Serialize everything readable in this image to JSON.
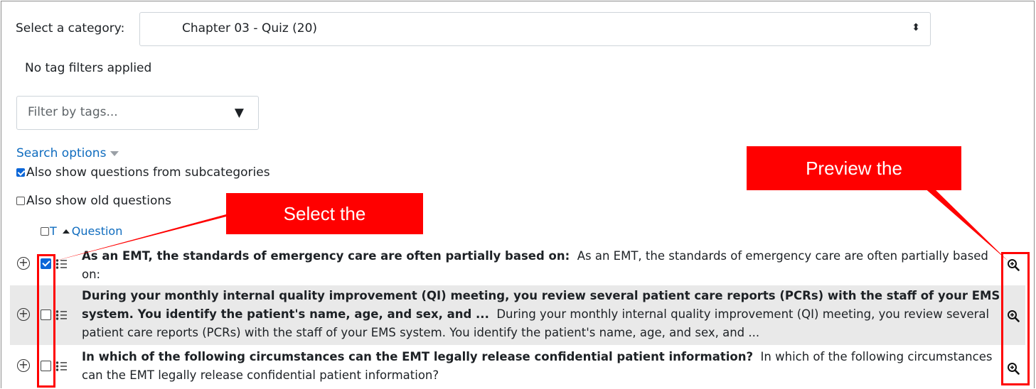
{
  "category": {
    "label": "Select a category:",
    "selected": "Chapter 03 - Quiz (20)",
    "arrow_glyph": "⬍"
  },
  "tags_status": "No tag filters applied",
  "tag_filter": {
    "placeholder": "Filter by tags...",
    "arrow_glyph": "▼"
  },
  "search_options": {
    "label": "Search options",
    "subcategories": {
      "label": "Also show questions from subcategories",
      "checked": true
    },
    "old_questions": {
      "label": "Also show old questions",
      "checked": false
    }
  },
  "table_header": {
    "type_col": "T",
    "question_col": "Question"
  },
  "rows": [
    {
      "checked": true,
      "name": "As an EMT, the standards of emergency care are often partially based on:",
      "text": "As an EMT, the standards of emergency care are often partially based on:"
    },
    {
      "checked": false,
      "name": "During your monthly internal quality improvement (QI) meeting, you review several patient care reports (PCRs) with the staff of your EMS system. You identify the patient's name, age, and sex, and ...",
      "text": "During your monthly internal quality improvement (QI) meeting, you review several patient care reports (PCRs) with the staff of your EMS system. You identify the patient's name, age, and sex, and ..."
    },
    {
      "checked": false,
      "name": "In which of the following circumstances can the EMT legally release confidential patient information?",
      "text": "In which of the following circumstances can the EMT legally release confidential patient information?"
    }
  ],
  "callouts": {
    "select": "Select the",
    "preview": "Preview the"
  },
  "colors": {
    "link": "#0f6cbf",
    "callout": "#ff0000",
    "row_alt": "#e9e9e9",
    "checkbox": "#0a66d8"
  },
  "icons": {
    "expand": "plus-circle-icon",
    "qtype": "multichoice-icon",
    "preview": "zoom-in-icon"
  }
}
